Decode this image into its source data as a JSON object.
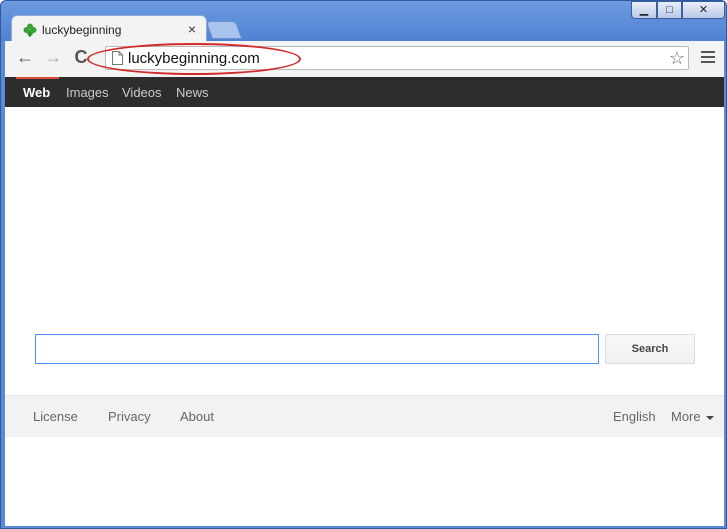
{
  "window": {
    "tab_title": "luckybeginning",
    "tab_close": "×",
    "controls": {
      "minimize": "▁",
      "maximize": "□",
      "close": "✕"
    }
  },
  "toolbar": {
    "url": "luckybeginning.com",
    "back": "←",
    "forward": "→",
    "reload": "C",
    "star": "☆"
  },
  "gbar": {
    "items": [
      "Web",
      "Images",
      "Videos",
      "News"
    ],
    "active_index": 0
  },
  "search": {
    "input_value": "",
    "button_label": "Search"
  },
  "footer": {
    "left": [
      "License",
      "Privacy",
      "About"
    ],
    "right": [
      "English",
      "More"
    ]
  },
  "colors": {
    "highlight_ellipse": "#d22a2a",
    "gbar_background": "#2d2d2d",
    "active_accent": "#dd4b39",
    "input_focus": "#4d90fe"
  }
}
